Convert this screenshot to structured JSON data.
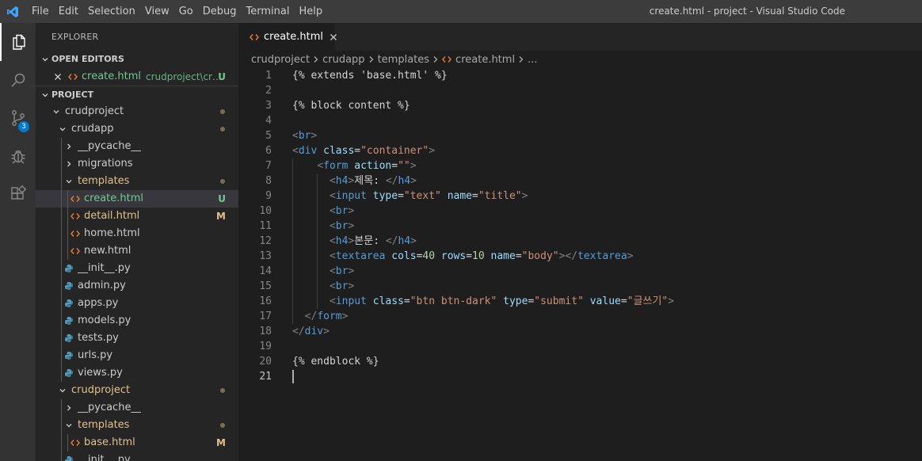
{
  "window": {
    "title": "create.html - project - Visual Studio Code"
  },
  "menu": [
    "File",
    "Edit",
    "Selection",
    "View",
    "Go",
    "Debug",
    "Terminal",
    "Help"
  ],
  "activity": {
    "scm_badge": "3"
  },
  "sidebar": {
    "title": "EXPLORER",
    "open_editors_header": "OPEN EDITORS",
    "open_editor": {
      "name": "create.html",
      "path": "crudproject\\crud...",
      "status": "U"
    },
    "project_header": "PROJECT",
    "tree": [
      {
        "name": "crudproject",
        "kind": "folder-open",
        "depth": 0,
        "dot": true
      },
      {
        "name": "crudapp",
        "kind": "folder-open",
        "depth": 1,
        "dot": true
      },
      {
        "name": "__pycache__",
        "kind": "folder-closed",
        "depth": 2
      },
      {
        "name": "migrations",
        "kind": "folder-closed",
        "depth": 2
      },
      {
        "name": "templates",
        "kind": "folder-open",
        "depth": 2,
        "dot": true,
        "color": "modified"
      },
      {
        "name": "create.html",
        "kind": "html",
        "depth": 3,
        "status": "U",
        "color": "untracked",
        "selected": true
      },
      {
        "name": "detail.html",
        "kind": "html",
        "depth": 3,
        "status": "M",
        "color": "modified"
      },
      {
        "name": "home.html",
        "kind": "html",
        "depth": 3
      },
      {
        "name": "new.html",
        "kind": "html",
        "depth": 3
      },
      {
        "name": "__init__.py",
        "kind": "py",
        "depth": 2
      },
      {
        "name": "admin.py",
        "kind": "py",
        "depth": 2
      },
      {
        "name": "apps.py",
        "kind": "py",
        "depth": 2
      },
      {
        "name": "models.py",
        "kind": "py",
        "depth": 2
      },
      {
        "name": "tests.py",
        "kind": "py",
        "depth": 2
      },
      {
        "name": "urls.py",
        "kind": "py",
        "depth": 2
      },
      {
        "name": "views.py",
        "kind": "py",
        "depth": 2
      },
      {
        "name": "crudproject",
        "kind": "folder-open",
        "depth": 1,
        "dot": true,
        "color": "modified"
      },
      {
        "name": "__pycache__",
        "kind": "folder-closed",
        "depth": 2
      },
      {
        "name": "templates",
        "kind": "folder-open",
        "depth": 2,
        "dot": true,
        "color": "modified"
      },
      {
        "name": "base.html",
        "kind": "html",
        "depth": 3,
        "status": "M",
        "color": "modified"
      },
      {
        "name": "__init__.py",
        "kind": "py",
        "depth": 2
      }
    ]
  },
  "tab": {
    "label": "create.html"
  },
  "breadcrumbs": [
    "crudproject",
    "crudapp",
    "templates",
    "create.html",
    "..."
  ],
  "editor": {
    "current_line": 21,
    "lines": [
      [
        [
          "txt",
          "{% extends 'base.html' %}"
        ]
      ],
      [],
      [
        [
          "txt",
          "{% block content %}"
        ]
      ],
      [],
      [
        [
          "punct",
          "<"
        ],
        [
          "tag",
          "br"
        ],
        [
          "punct",
          ">"
        ]
      ],
      [
        [
          "punct",
          "<"
        ],
        [
          "tag",
          "div"
        ],
        [
          "txt",
          " "
        ],
        [
          "attr",
          "class"
        ],
        [
          "txt",
          "="
        ],
        [
          "str",
          "\"container\""
        ],
        [
          "punct",
          ">"
        ]
      ],
      [
        [
          "txt",
          "    "
        ],
        [
          "punct",
          "<"
        ],
        [
          "tag",
          "form"
        ],
        [
          "txt",
          " "
        ],
        [
          "attr",
          "action"
        ],
        [
          "txt",
          "="
        ],
        [
          "str",
          "\"\""
        ],
        [
          "punct",
          ">"
        ]
      ],
      [
        [
          "txt",
          "      "
        ],
        [
          "punct",
          "<"
        ],
        [
          "tag",
          "h4"
        ],
        [
          "punct",
          ">"
        ],
        [
          "txt",
          "제목: "
        ],
        [
          "punct",
          "</"
        ],
        [
          "tag",
          "h4"
        ],
        [
          "punct",
          ">"
        ]
      ],
      [
        [
          "txt",
          "      "
        ],
        [
          "punct",
          "<"
        ],
        [
          "tag",
          "input"
        ],
        [
          "txt",
          " "
        ],
        [
          "attr",
          "type"
        ],
        [
          "txt",
          "="
        ],
        [
          "str",
          "\"text\""
        ],
        [
          "txt",
          " "
        ],
        [
          "attr",
          "name"
        ],
        [
          "txt",
          "="
        ],
        [
          "str",
          "\"title\""
        ],
        [
          "punct",
          ">"
        ]
      ],
      [
        [
          "txt",
          "      "
        ],
        [
          "punct",
          "<"
        ],
        [
          "tag",
          "br"
        ],
        [
          "punct",
          ">"
        ]
      ],
      [
        [
          "txt",
          "      "
        ],
        [
          "punct",
          "<"
        ],
        [
          "tag",
          "br"
        ],
        [
          "punct",
          ">"
        ]
      ],
      [
        [
          "txt",
          "      "
        ],
        [
          "punct",
          "<"
        ],
        [
          "tag",
          "h4"
        ],
        [
          "punct",
          ">"
        ],
        [
          "txt",
          "본문: "
        ],
        [
          "punct",
          "</"
        ],
        [
          "tag",
          "h4"
        ],
        [
          "punct",
          ">"
        ]
      ],
      [
        [
          "txt",
          "      "
        ],
        [
          "punct",
          "<"
        ],
        [
          "tag",
          "textarea"
        ],
        [
          "txt",
          " "
        ],
        [
          "attr",
          "cols"
        ],
        [
          "txt",
          "="
        ],
        [
          "num",
          "40"
        ],
        [
          "txt",
          " "
        ],
        [
          "attr",
          "rows"
        ],
        [
          "txt",
          "="
        ],
        [
          "num",
          "10"
        ],
        [
          "txt",
          " "
        ],
        [
          "attr",
          "name"
        ],
        [
          "txt",
          "="
        ],
        [
          "str",
          "\"body\""
        ],
        [
          "punct",
          "></"
        ],
        [
          "tag",
          "textarea"
        ],
        [
          "punct",
          ">"
        ]
      ],
      [
        [
          "txt",
          "      "
        ],
        [
          "punct",
          "<"
        ],
        [
          "tag",
          "br"
        ],
        [
          "punct",
          ">"
        ]
      ],
      [
        [
          "txt",
          "      "
        ],
        [
          "punct",
          "<"
        ],
        [
          "tag",
          "br"
        ],
        [
          "punct",
          ">"
        ]
      ],
      [
        [
          "txt",
          "      "
        ],
        [
          "punct",
          "<"
        ],
        [
          "tag",
          "input"
        ],
        [
          "txt",
          " "
        ],
        [
          "attr",
          "class"
        ],
        [
          "txt",
          "="
        ],
        [
          "str",
          "\"btn btn-dark\""
        ],
        [
          "txt",
          " "
        ],
        [
          "attr",
          "type"
        ],
        [
          "txt",
          "="
        ],
        [
          "str",
          "\"submit\""
        ],
        [
          "txt",
          " "
        ],
        [
          "attr",
          "value"
        ],
        [
          "txt",
          "="
        ],
        [
          "str",
          "\"글쓰기\""
        ],
        [
          "punct",
          ">"
        ]
      ],
      [
        [
          "txt",
          "  "
        ],
        [
          "punct",
          "</"
        ],
        [
          "tag",
          "form"
        ],
        [
          "punct",
          ">"
        ]
      ],
      [
        [
          "punct",
          "</"
        ],
        [
          "tag",
          "div"
        ],
        [
          "punct",
          ">"
        ]
      ],
      [],
      [
        [
          "txt",
          "{% endblock %}"
        ]
      ],
      []
    ]
  },
  "colors": {
    "accent": "#007acc",
    "untracked": "#73c991",
    "modified": "#e2c08d",
    "html_icon": "#e37933",
    "py_icon": "#519aba"
  }
}
